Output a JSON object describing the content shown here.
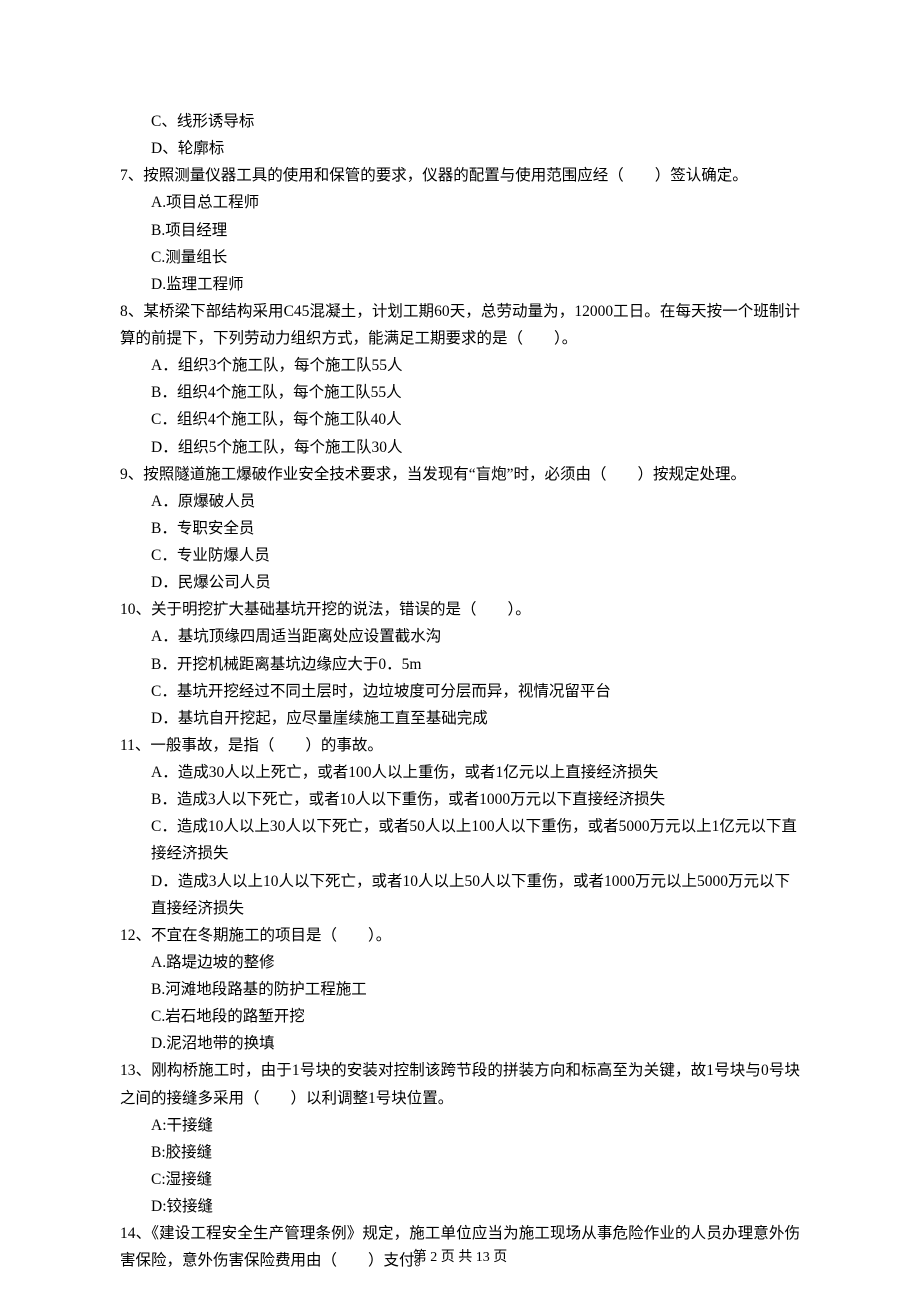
{
  "q6_tail": {
    "opts": [
      {
        "label": "C、线形诱导标"
      },
      {
        "label": "D、轮廓标"
      }
    ]
  },
  "q7": {
    "stem": "7、按照测量仪器工具的使用和保管的要求，仪器的配置与使用范围应经（　　）签认确定。",
    "opts": [
      {
        "label": "A.项目总工程师"
      },
      {
        "label": "B.项目经理"
      },
      {
        "label": "C.测量组长"
      },
      {
        "label": "D.监理工程师"
      }
    ]
  },
  "q8": {
    "stem": "8、某桥梁下部结构采用C45混凝土，计划工期60天，总劳动量为，12000工日。在每天按一个班制计算的前提下，下列劳动力组织方式，能满足工期要求的是（　　）。",
    "opts": [
      {
        "label": "A．组织3个施工队，每个施工队55人"
      },
      {
        "label": "B．组织4个施工队，每个施工队55人"
      },
      {
        "label": "C．组织4个施工队，每个施工队40人"
      },
      {
        "label": "D．组织5个施工队，每个施工队30人"
      }
    ]
  },
  "q9": {
    "stem": "9、按照隧道施工爆破作业安全技术要求，当发现有“盲炮”时，必须由（　　）按规定处理。",
    "opts": [
      {
        "label": "A．原爆破人员"
      },
      {
        "label": "B．专职安全员"
      },
      {
        "label": "C．专业防爆人员"
      },
      {
        "label": "D．民爆公司人员"
      }
    ]
  },
  "q10": {
    "stem": "10、关于明挖扩大基础基坑开挖的说法，错误的是（　　）。",
    "opts": [
      {
        "label": "A．基坑顶缘四周适当距离处应设置截水沟"
      },
      {
        "label": "B．开挖机械距离基坑边缘应大于0．5m"
      },
      {
        "label": "C．基坑开挖经过不同土层时，边垃坡度可分层而异，视情况留平台"
      },
      {
        "label": "D．基坑自开挖起，应尽量崖续施工直至基础完成"
      }
    ]
  },
  "q11": {
    "stem": "11、一般事故，是指（　　）的事故。",
    "opts": [
      {
        "label": "A．造成30人以上死亡，或者100人以上重伤，或者1亿元以上直接经济损失"
      },
      {
        "label": "B．造成3人以下死亡，或者10人以下重伤，或者1000万元以下直接经济损失"
      },
      {
        "label": "C．造成10人以上30人以下死亡，或者50人以上100人以下重伤，或者5000万元以上1亿元以下直接经济损失"
      },
      {
        "label": "D．造成3人以上10人以下死亡，或者10人以上50人以下重伤，或者1000万元以上5000万元以下直接经济损失"
      }
    ]
  },
  "q12": {
    "stem": "12、不宜在冬期施工的项目是（　　）。",
    "opts": [
      {
        "label": "A.路堤边坡的整修"
      },
      {
        "label": "B.河滩地段路基的防护工程施工"
      },
      {
        "label": "C.岩石地段的路堑开挖"
      },
      {
        "label": "D.泥沼地带的换填"
      }
    ]
  },
  "q13": {
    "stem": "13、刚构桥施工时，由于1号块的安装对控制该跨节段的拼装方向和标高至为关键，故1号块与0号块之间的接缝多采用（　　）以利调整1号块位置。",
    "opts": [
      {
        "label": "A:干接缝"
      },
      {
        "label": "B:胶接缝"
      },
      {
        "label": "C:湿接缝"
      },
      {
        "label": "D:铰接缝"
      }
    ]
  },
  "q14": {
    "stem": "14、《建设工程安全生产管理条例》规定，施工单位应当为施工现场从事危险作业的人员办理意外伤害保险，意外伤害保险费用由（　　）支付。"
  },
  "footer": "第 2 页 共 13 页"
}
